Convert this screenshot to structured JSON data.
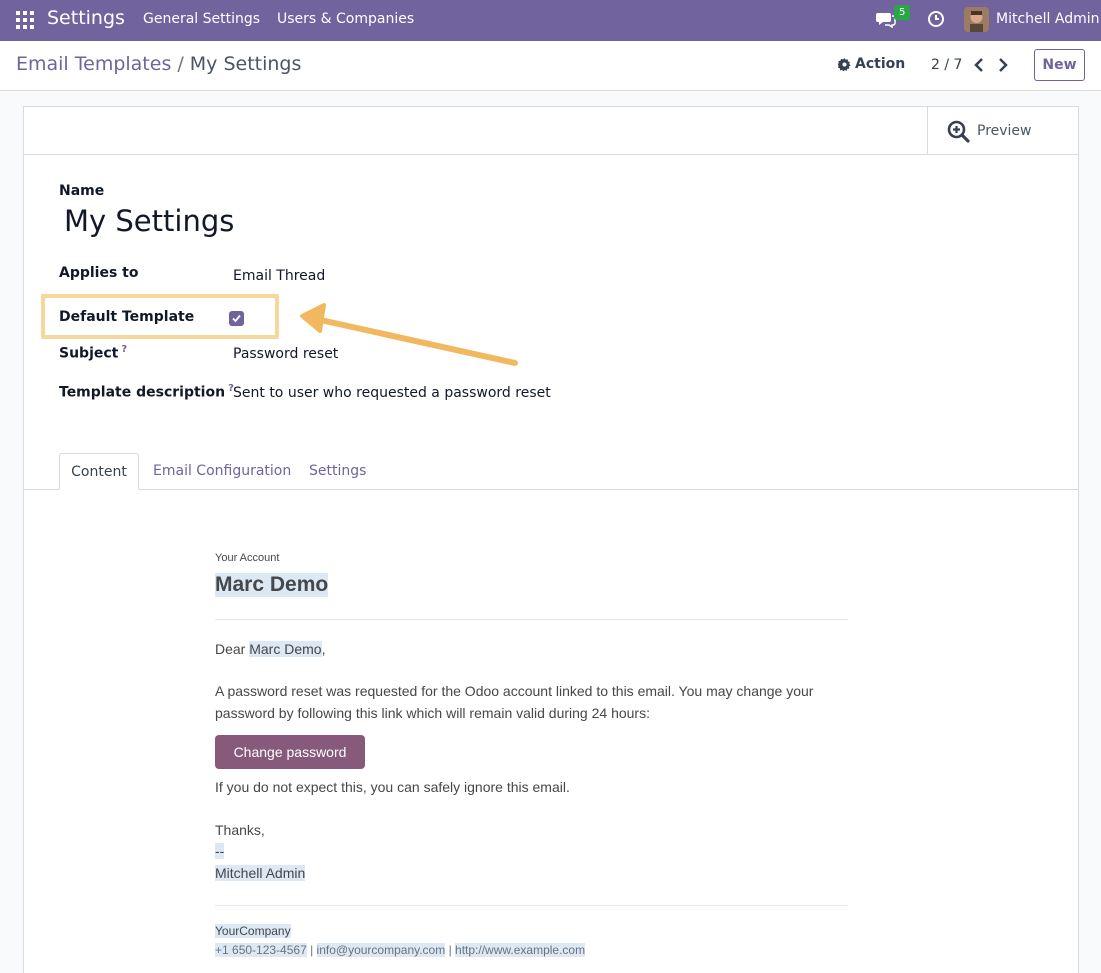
{
  "navbar": {
    "brand": "Settings",
    "menu": [
      "General Settings",
      "Users & Companies"
    ],
    "message_count": "5",
    "user_name": "Mitchell Admin"
  },
  "control_panel": {
    "breadcrumb_parent": "Email Templates",
    "breadcrumb_separator": "/",
    "breadcrumb_current": "My Settings",
    "action_label": "Action",
    "pager_value": "2 / 7",
    "new_label": "New"
  },
  "form": {
    "preview_label": "Preview",
    "name_label": "Name",
    "name_value": "My Settings",
    "applies_to_label": "Applies to",
    "applies_to_value": "Email Thread",
    "default_template_label": "Default Template",
    "default_template_checked": true,
    "subject_label": "Subject",
    "subject_value": "Password reset",
    "template_description_label": "Template description",
    "template_description_value": "Sent to user who requested a password reset",
    "help_mark": "?"
  },
  "tabs": [
    "Content",
    "Email Configuration",
    "Settings"
  ],
  "email": {
    "eyebrow": "Your Account",
    "title": "Marc Demo",
    "greeting_prefix": "Dear ",
    "greeting_name": "Marc Demo",
    "greeting_suffix": ",",
    "body": "A password reset was requested for the Odoo account linked to this email. You may change your password by following this link which will remain valid during 24 hours:",
    "button_label": "Change password",
    "ignore_text": "If you do not expect this, you can safely ignore this email.",
    "thanks": "Thanks,",
    "signature_dash": "--",
    "signature_name": "Mitchell Admin",
    "company_name": "YourCompany",
    "company_phone": "+1 650-123-4567",
    "company_email": "info@yourcompany.com",
    "company_website": "http://www.example.com",
    "footer_separator": " | "
  },
  "colors": {
    "brand": "#71639e",
    "button": "#875a7b",
    "highlight_box": "#f7d79b",
    "arrow": "#f2b860"
  }
}
